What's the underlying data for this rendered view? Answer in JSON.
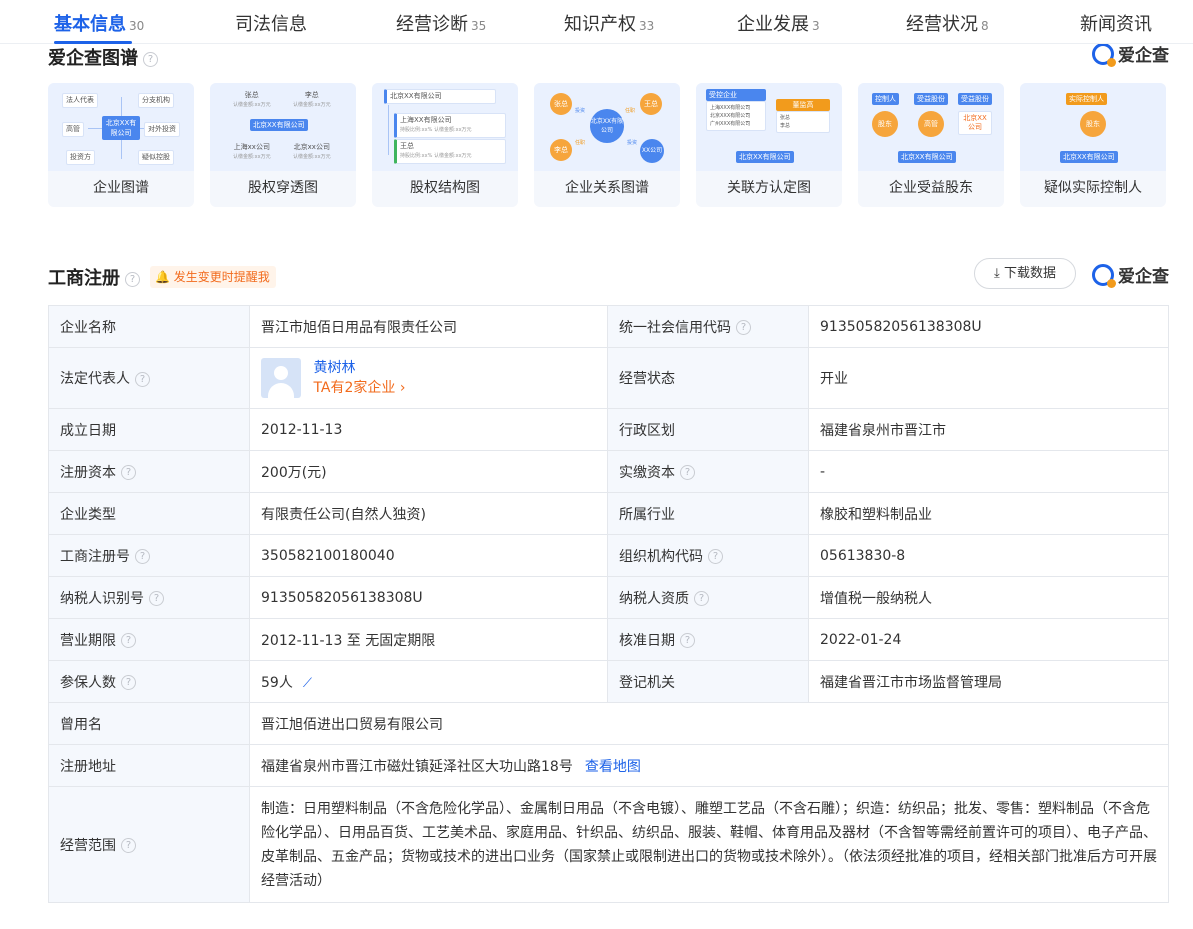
{
  "tabs": [
    {
      "label": "基本信息",
      "count": "30"
    },
    {
      "label": "司法信息",
      "count": ""
    },
    {
      "label": "经营诊断",
      "count": "35"
    },
    {
      "label": "知识产权",
      "count": "33"
    },
    {
      "label": "企业发展",
      "count": "3"
    },
    {
      "label": "经营状况",
      "count": "8"
    },
    {
      "label": "新闻资讯",
      "count": ""
    }
  ],
  "brand": "爱企查",
  "graph_section": {
    "title": "爱企查图谱",
    "cards": [
      {
        "label": "企业图谱",
        "nodes": {
          "center": "北京XX有限公司",
          "items": [
            "法人代表",
            "分支机构",
            "高管",
            "对外投资",
            "投资方",
            "疑似控股"
          ]
        }
      },
      {
        "label": "股权穿透图",
        "nodes": {
          "a": "张总",
          "b": "李总",
          "a_sub": "认缴金额:xx万元",
          "b_sub": "认缴金额:xx万元",
          "center": "北京XX有限公司",
          "c": "上海xx公司",
          "d": "北京xx公司",
          "c_sub": "认缴金额:xx万元",
          "d_sub": "认缴金额:xx万元"
        }
      },
      {
        "label": "股权结构图",
        "nodes": {
          "top": "北京XX有限公司",
          "mid": "上海XX有限公司",
          "mid_sub": "持股比例:xx%  认缴金额:xx万元",
          "bot": "王总",
          "bot_sub": "持股比例:xx%  认缴金额:xx万元"
        }
      },
      {
        "label": "企业关系图谱",
        "nodes": {
          "center": "北京XX有限公司",
          "a": "张总",
          "b": "王总",
          "c": "李总",
          "d": "XX公司",
          "e1": "投资",
          "e2": "任职",
          "e3": "任职",
          "e4": "投资"
        }
      },
      {
        "label": "关联方认定图",
        "nodes": {
          "head": "受控企业",
          "list": [
            "上海XXX有限公司",
            "北京XXX有限公司",
            "广州XXX有限公司"
          ],
          "head2": "董监高",
          "list2": [
            "张总",
            "李总"
          ],
          "bottom": "北京XX有限公司"
        }
      },
      {
        "label": "企业受益股东",
        "nodes": {
          "h1": "控制人",
          "h2": "受益股份",
          "h3": "受益股份",
          "c1": "股东",
          "c2": "高管",
          "c3": "北京XX公司",
          "bottom": "北京XX有限公司"
        }
      },
      {
        "label": "疑似实际控制人",
        "nodes": {
          "top": "实际控制人",
          "mid": "股东",
          "bottom": "北京XX有限公司"
        }
      }
    ]
  },
  "registration": {
    "title": "工商注册",
    "alert": "发生变更时提醒我",
    "download": "下载数据",
    "rows": [
      {
        "k1": "企业名称",
        "v1": "晋江市旭佰日用品有限责任公司",
        "k2": "统一社会信用代码",
        "v2": "91350582056138308U"
      },
      {
        "k1": "法定代表人",
        "v1_name": "黄树林",
        "v1_link": "TA有2家企业",
        "k2": "经营状态",
        "v2": "开业"
      },
      {
        "k1": "成立日期",
        "v1": "2012-11-13",
        "k2": "行政区划",
        "v2": "福建省泉州市晋江市"
      },
      {
        "k1": "注册资本",
        "v1": "200万(元)",
        "k2": "实缴资本",
        "v2": "-"
      },
      {
        "k1": "企业类型",
        "v1": "有限责任公司(自然人独资)",
        "k2": "所属行业",
        "v2": "橡胶和塑料制品业"
      },
      {
        "k1": "工商注册号",
        "v1": "350582100180040",
        "k2": "组织机构代码",
        "v2": "05613830-8"
      },
      {
        "k1": "纳税人识别号",
        "v1": "91350582056138308U",
        "k2": "纳税人资质",
        "v2": "增值税一般纳税人"
      },
      {
        "k1": "营业期限",
        "v1": "2012-11-13 至 无固定期限",
        "k2": "核准日期",
        "v2": "2022-01-24"
      },
      {
        "k1": "参保人数",
        "v1": "59人",
        "k2": "登记机关",
        "v2": "福建省晋江市市场监督管理局"
      }
    ],
    "former_name_label": "曾用名",
    "former_name": "晋江旭佰进出口贸易有限公司",
    "address_label": "注册地址",
    "address": "福建省泉州市晋江市磁灶镇延泽社区大功山路18号",
    "map_link": "查看地图",
    "scope_label": "经营范围",
    "scope": "制造：日用塑料制品（不含危险化学品）、金属制日用品（不含电镀）、雕塑工艺品（不含石雕）；织造：纺织品；批发、零售：塑料制品（不含危险化学品）、日用品百货、工艺美术品、家庭用品、针织品、纺织品、服装、鞋帽、体育用品及器材（不含智等需经前置许可的项目）、电子产品、皮革制品、五金产品；货物或技术的进出口业务（国家禁止或限制进出口的货物或技术除外）。（依法须经批准的项目，经相关部门批准后方可开展经营活动）"
  },
  "colors": {
    "accent": "#1d62e8",
    "orange": "#f26b1d",
    "key_bg": "#f5f8fd"
  }
}
